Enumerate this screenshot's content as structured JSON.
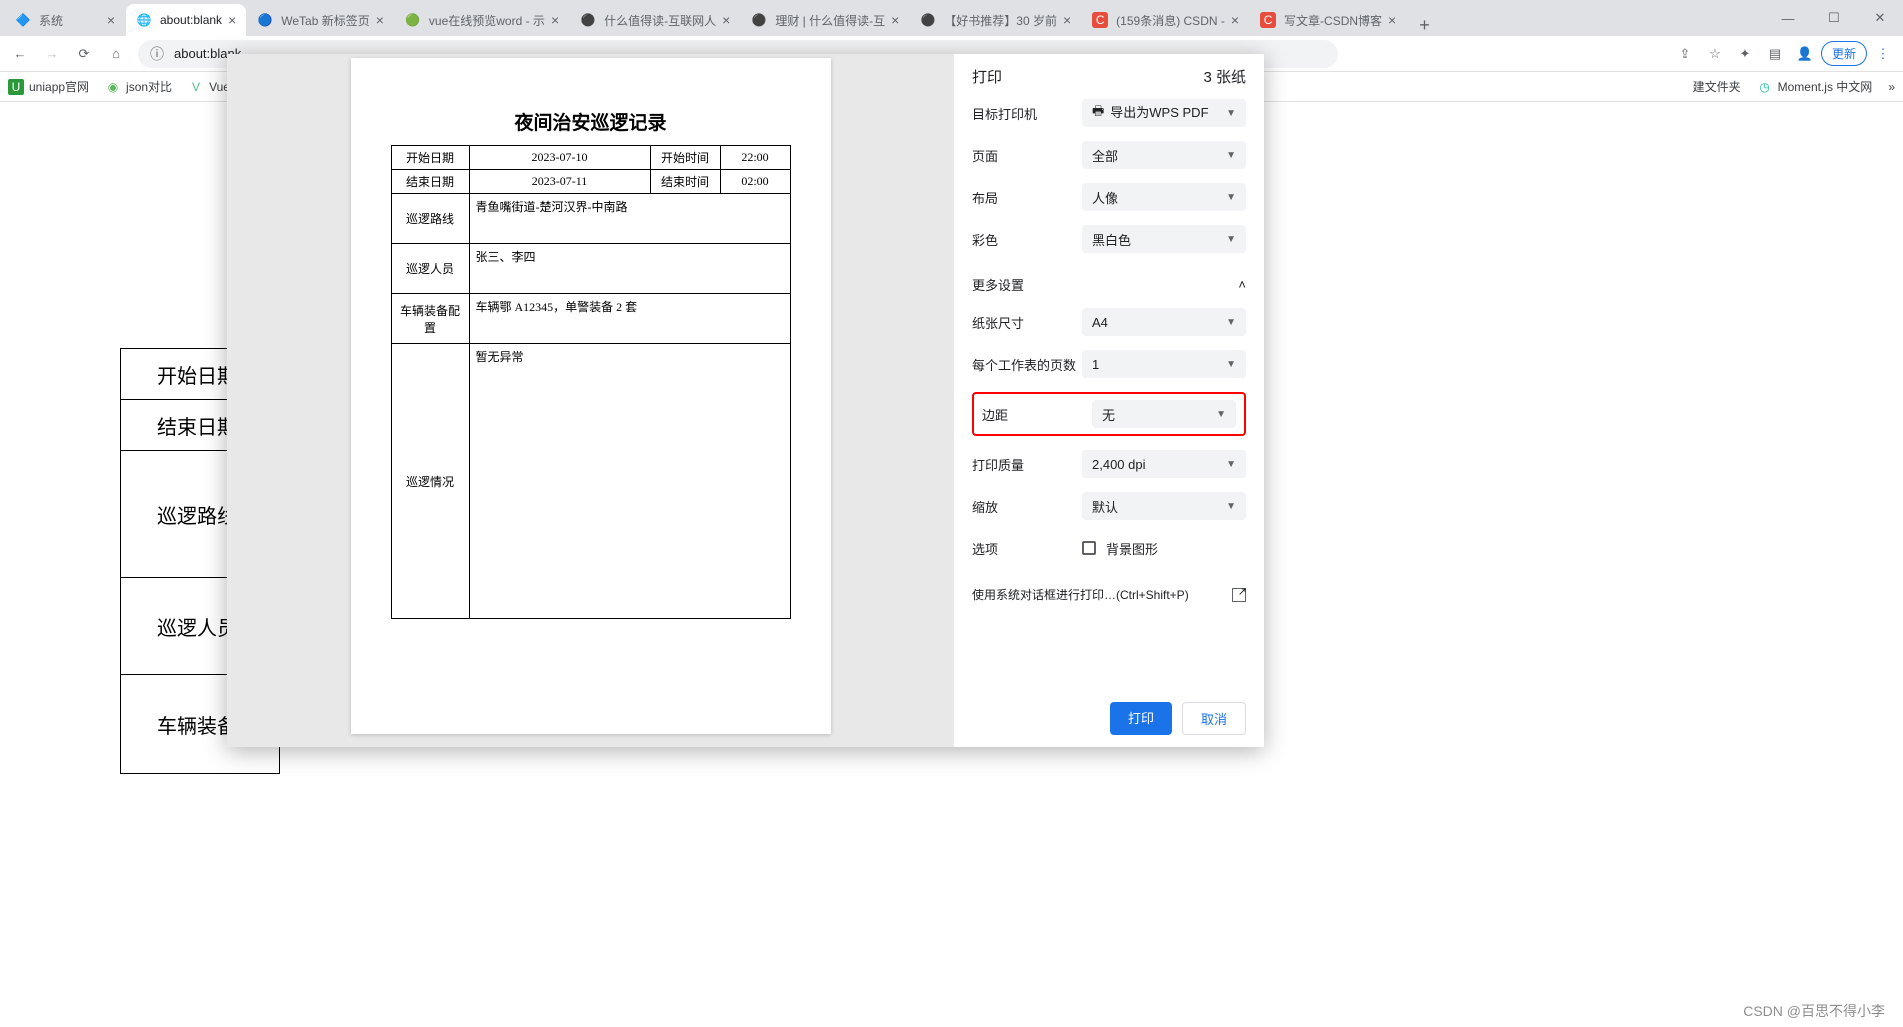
{
  "window": {
    "tabs": [
      {
        "title": "系统",
        "favicon": "🔷"
      },
      {
        "title": "about:blank",
        "favicon": "🌐",
        "active": true
      },
      {
        "title": "WeTab 新标签页",
        "favicon": "🔵"
      },
      {
        "title": "vue在线预览word - 示",
        "favicon": "🟢"
      },
      {
        "title": "什么值得读-互联网人",
        "favicon": "⚫"
      },
      {
        "title": "理财 | 什么值得读-互",
        "favicon": "⚫"
      },
      {
        "title": "【好书推荐】30 岁前",
        "favicon": "⚫"
      },
      {
        "title": "(159条消息) CSDN - ",
        "favicon": "C"
      },
      {
        "title": "写文章-CSDN博客",
        "favicon": "C"
      }
    ],
    "update_button": "更新"
  },
  "address": {
    "url": "about:blank"
  },
  "bookmarks": [
    {
      "icon": "U",
      "color": "#2b9939",
      "label": "uniapp官网"
    },
    {
      "icon": "◉",
      "color": "#5cb85c",
      "label": "json对比"
    },
    {
      "icon": "V",
      "color": "#4fc08d",
      "label": "Vue.js官网"
    }
  ],
  "bookmarks_right": [
    {
      "label": "建文件夹"
    },
    {
      "icon": "◷",
      "color": "#1abc9c",
      "label": "Moment.js 中文网"
    }
  ],
  "bg_labels": [
    "开始日期",
    "结束日期",
    "巡逻路线",
    "巡逻人员",
    "车辆装备配"
  ],
  "document": {
    "title": "夜间治安巡逻记录",
    "rows": {
      "start_date_label": "开始日期",
      "start_date": "2023-07-10",
      "start_time_label": "开始时间",
      "start_time": "22:00",
      "end_date_label": "结束日期",
      "end_date": "2023-07-11",
      "end_time_label": "结束时间",
      "end_time": "02:00",
      "route_label": "巡逻路线",
      "route": "青鱼嘴街道-楚河汉界-中南路",
      "personnel_label": "巡逻人员",
      "personnel": "张三、李四",
      "equipment_label": "车辆装备配置",
      "equipment": "车辆鄂 A12345，单警装备 2 套",
      "situation_label": "巡逻情况",
      "situation": "暂无异常"
    }
  },
  "print": {
    "title": "打印",
    "pages": "3 张纸",
    "settings": {
      "destination_label": "目标打印机",
      "destination_value": "导出为WPS PDF",
      "pages_label": "页面",
      "pages_value": "全部",
      "layout_label": "布局",
      "layout_value": "人像",
      "color_label": "彩色",
      "color_value": "黑白色",
      "more_label": "更多设置",
      "paper_label": "纸张尺寸",
      "paper_value": "A4",
      "sheets_label": "每个工作表的页数",
      "sheets_value": "1",
      "margin_label": "边距",
      "margin_value": "无",
      "quality_label": "打印质量",
      "quality_value": "2,400 dpi",
      "scale_label": "缩放",
      "scale_value": "默认",
      "options_label": "选项",
      "bg_graphics_label": "背景图形",
      "system_dialog": "使用系统对话框进行打印…(Ctrl+Shift+P)"
    },
    "print_btn": "打印",
    "cancel_btn": "取消"
  },
  "watermark": "CSDN @百思不得小李"
}
